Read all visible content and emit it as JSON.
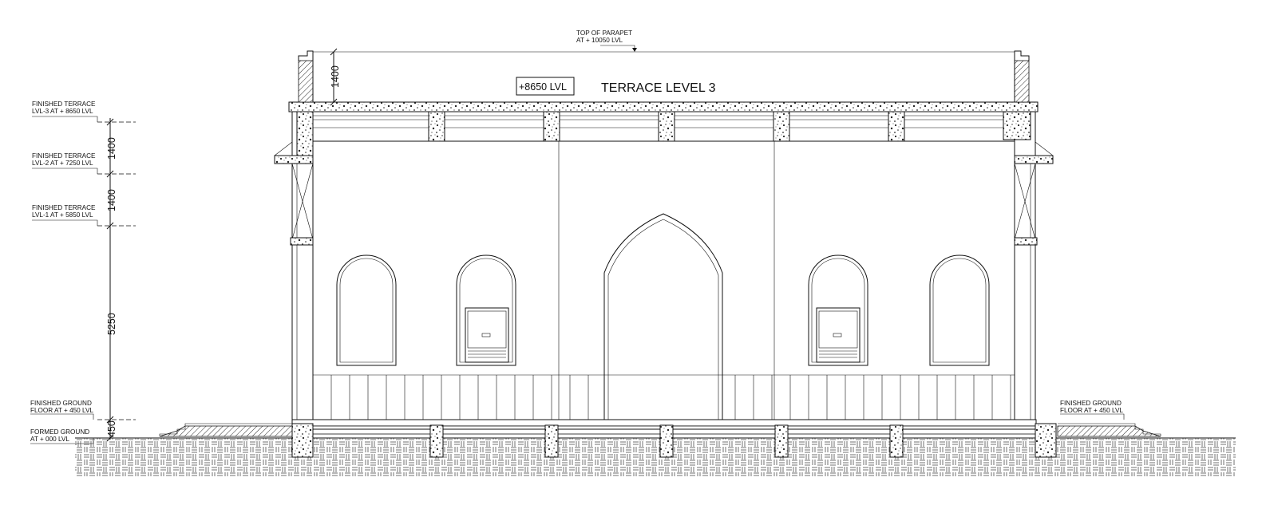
{
  "top_label": {
    "line1": "TOP OF  PARAPET",
    "line2": "AT + 10050 LVL"
  },
  "terrace_title": "TERRACE LEVEL 3",
  "level_box": "+8650 LVL",
  "parapet_dimension": "1400",
  "left_labels": [
    {
      "line1": "FINISHED TERRACE",
      "line2": "LVL-3  AT + 8650 LVL"
    },
    {
      "line1": "FINISHED TERRACE",
      "line2": "LVL-2  AT + 7250 LVL"
    },
    {
      "line1": "FINISHED TERRACE",
      "line2": "LVL-1  AT + 5850 LVL"
    },
    {
      "line1": "FINISHED GROUND",
      "line2": "FLOOR AT + 450  LVL"
    },
    {
      "line1": "FORMED GROUND",
      "line2": "AT + 000  LVL"
    }
  ],
  "right_label": {
    "line1": "FINISHED GROUND",
    "line2": "FLOOR AT + 450  LVL"
  },
  "vertical_dimensions": [
    "1400",
    "1400",
    "5250",
    "450"
  ],
  "colors": {
    "line": "#111111",
    "background": "#ffffff"
  }
}
